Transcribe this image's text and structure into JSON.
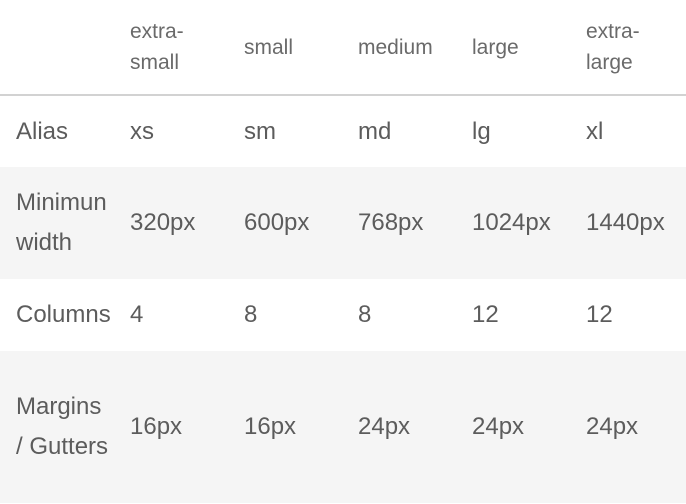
{
  "table": {
    "headers": [
      "",
      "extra-\nsmall",
      "small",
      "medium",
      "large",
      "extra-\nlarge"
    ],
    "header_lines": [
      [
        ""
      ],
      [
        "extra-",
        "small"
      ],
      [
        "small"
      ],
      [
        "medium"
      ],
      [
        "large"
      ],
      [
        "extra-",
        "large"
      ]
    ],
    "rows": [
      {
        "label": "Alias",
        "values": [
          "xs",
          "sm",
          "md",
          "lg",
          "xl"
        ]
      },
      {
        "label": "Minimun width",
        "values": [
          "320px",
          "600px",
          "768px",
          "1024px",
          "1440px"
        ]
      },
      {
        "label": "Columns",
        "values": [
          "4",
          "8",
          "8",
          "12",
          "12"
        ]
      },
      {
        "label": "Margins / Gutters",
        "values": [
          "16px",
          "16px",
          "24px",
          "24px",
          "24px"
        ]
      }
    ]
  },
  "colors": {
    "text": "#5c5c5c",
    "alt_row_bg": "#f5f5f5",
    "header_rule": "#d2d2d2"
  }
}
